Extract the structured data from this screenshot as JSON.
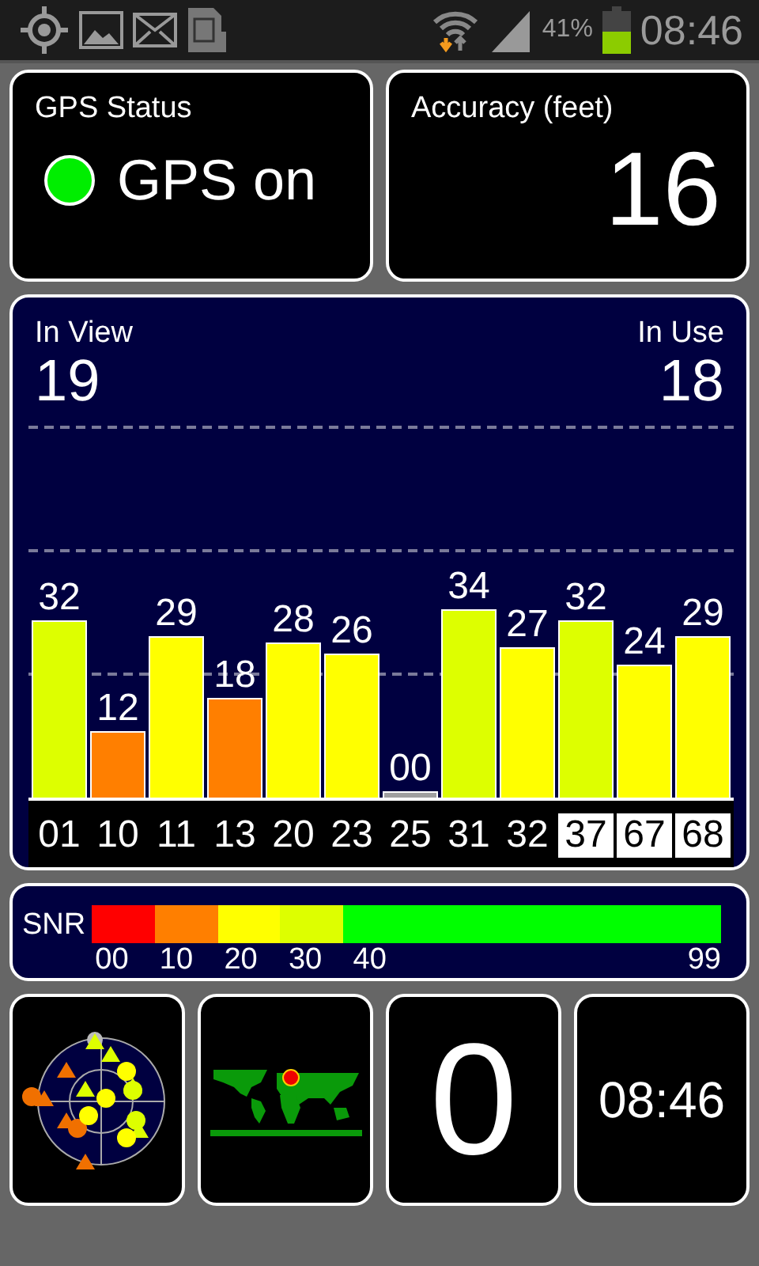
{
  "status_bar": {
    "battery_percent": "41%",
    "time": "08:46"
  },
  "gps_status": {
    "title": "GPS Status",
    "on": true,
    "value": "GPS on"
  },
  "accuracy": {
    "title": "Accuracy (feet)",
    "value": "16"
  },
  "satellites": {
    "in_view_label": "In View",
    "in_view": "19",
    "in_use_label": "In Use",
    "in_use": "18",
    "items": [
      {
        "prn": "01",
        "snr": "32",
        "color": "#ddff00",
        "highlighted": false
      },
      {
        "prn": "10",
        "snr": "12",
        "color": "#ff7f00",
        "highlighted": false
      },
      {
        "prn": "11",
        "snr": "29",
        "color": "#ffff00",
        "highlighted": false
      },
      {
        "prn": "13",
        "snr": "18",
        "color": "#ff7f00",
        "highlighted": false
      },
      {
        "prn": "20",
        "snr": "28",
        "color": "#ffff00",
        "highlighted": false
      },
      {
        "prn": "23",
        "snr": "26",
        "color": "#ffff00",
        "highlighted": false
      },
      {
        "prn": "25",
        "snr": "00",
        "color": "#a0a0a0",
        "highlighted": false
      },
      {
        "prn": "31",
        "snr": "34",
        "color": "#ddff00",
        "highlighted": false
      },
      {
        "prn": "32",
        "snr": "27",
        "color": "#ffff00",
        "highlighted": false
      },
      {
        "prn": "37",
        "snr": "32",
        "color": "#ddff00",
        "highlighted": true
      },
      {
        "prn": "67",
        "snr": "24",
        "color": "#ffff00",
        "highlighted": true
      },
      {
        "prn": "68",
        "snr": "29",
        "color": "#ffff00",
        "highlighted": true
      }
    ]
  },
  "snr_legend": {
    "label": "SNR",
    "end_label": "99",
    "segments": [
      {
        "label": "00",
        "color": "#ff0000"
      },
      {
        "label": "10",
        "color": "#ff7f00"
      },
      {
        "label": "20",
        "color": "#ffff00"
      },
      {
        "label": "30",
        "color": "#ddff00"
      },
      {
        "label": "40",
        "color": "#00ff00"
      }
    ]
  },
  "tiles": {
    "count": "0",
    "clock": "08:46"
  }
}
